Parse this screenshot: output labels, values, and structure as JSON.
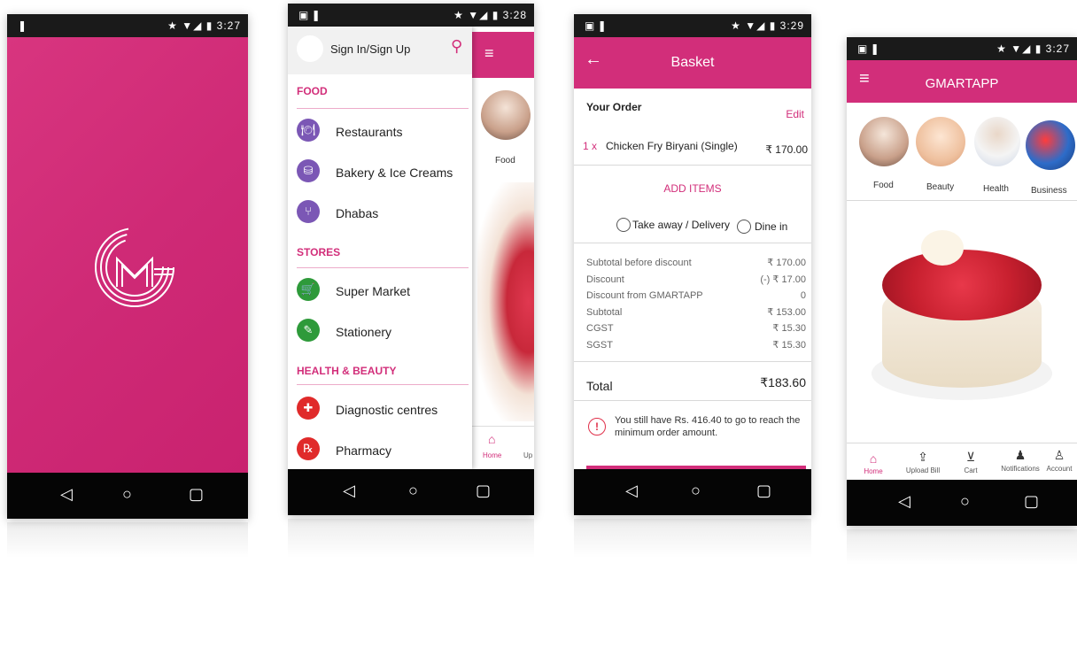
{
  "status": {
    "time1": "3:27",
    "time2": "3:28",
    "time3": "3:29",
    "time4": "3:27",
    "icons": "★ ▼◢ ▮"
  },
  "splash": {
    "logo_text": "GM"
  },
  "drawer": {
    "signin": "Sign In/Sign Up",
    "sections": {
      "food": "FOOD",
      "stores": "STORES",
      "health": "HEALTH & BEAUTY"
    },
    "items": {
      "restaurants": "Restaurants",
      "bakery": "Bakery & Ice Creams",
      "dhabas": "Dhabas",
      "supermarket": "Super Market",
      "stationery": "Stationery",
      "diagnostic": "Diagnostic centres",
      "pharmacy": "Pharmacy"
    },
    "peek": {
      "food": "Food",
      "home": "Home",
      "up": "Up"
    }
  },
  "basket": {
    "title": "Basket",
    "your_order": "Your Order",
    "edit": "Edit",
    "qty": "1 x",
    "item_name": "Chicken Fry Biryani (Single)",
    "item_price": "₹ 170.00",
    "add_items": "ADD ITEMS",
    "opt_takeaway": "Take away / Delivery",
    "opt_dine": "Dine in",
    "lines": [
      {
        "label": "Subtotal before discount",
        "value": "₹ 170.00"
      },
      {
        "label": "Discount",
        "value": "(-) ₹ 17.00"
      },
      {
        "label": "Discount from GMARTAPP",
        "value": "0"
      },
      {
        "label": "Subtotal",
        "value": "₹ 153.00"
      },
      {
        "label": "CGST",
        "value": "₹ 15.30"
      },
      {
        "label": "SGST",
        "value": "₹ 15.30"
      }
    ],
    "total_label": "Total",
    "total_value": "₹183.60",
    "notice": "You still have Rs. 416.40 to go to reach the minimum order amount."
  },
  "home": {
    "title": "GMARTAPP",
    "categories": {
      "food": "Food",
      "beauty": "Beauty",
      "health": "Health",
      "business": "Business"
    },
    "bottom_nav": {
      "home": "Home",
      "upload": "Upload Bill",
      "cart": "Cart",
      "notifications": "Notifications",
      "account": "Account"
    }
  },
  "colors": {
    "brand": "#d22e7a",
    "nav": "#050505"
  }
}
